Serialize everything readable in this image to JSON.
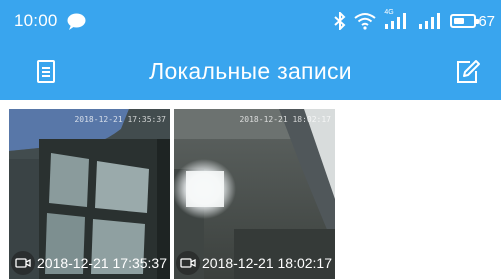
{
  "status_bar": {
    "time": "10:00",
    "network_label": "4G",
    "battery_percent": "67",
    "icons": [
      "chat-bubble-icon",
      "bluetooth-icon",
      "wifi-icon",
      "signal-icon",
      "battery-icon"
    ]
  },
  "toolbar": {
    "title": "Локальные записи",
    "left_icon": "list-icon",
    "right_icon": "edit-icon",
    "background": "#39a5ee"
  },
  "recordings": [
    {
      "watermark": "2018-12-21 17:35:37",
      "timestamp": "2018-12-21 17:35:37",
      "icon": "video-camera-icon"
    },
    {
      "watermark": "2018-12-21 18:02:17",
      "timestamp": "2018-12-21 18:02:17",
      "icon": "video-camera-icon"
    }
  ]
}
